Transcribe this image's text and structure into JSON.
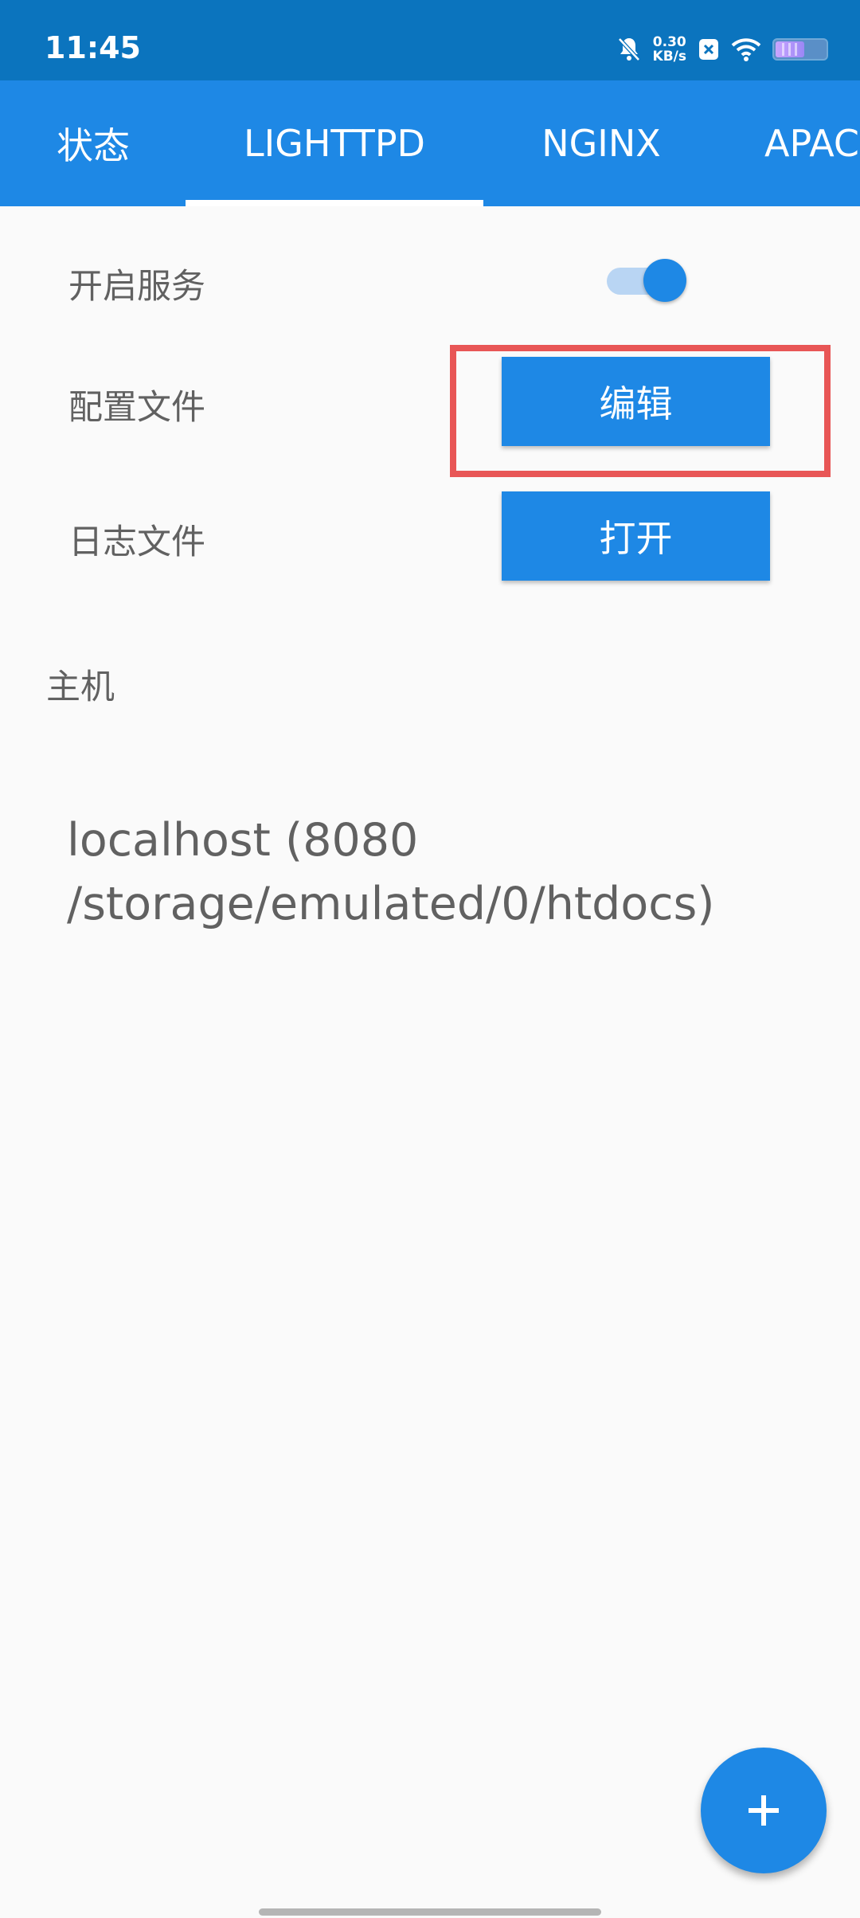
{
  "status_bar": {
    "time": "11:45",
    "net_speed_value": "0.30",
    "net_speed_unit": "KB/s",
    "icons": [
      "notifications-off-icon",
      "nfc-x-icon",
      "wifi-icon",
      "battery-icon"
    ]
  },
  "tabs": [
    {
      "label": "状态",
      "selected": false
    },
    {
      "label": "LIGHTTPD",
      "selected": true
    },
    {
      "label": "NGINX",
      "selected": false
    },
    {
      "label": "APAC",
      "selected": false
    }
  ],
  "settings": {
    "service_label": "开启服务",
    "service_enabled": true,
    "config_label": "配置文件",
    "config_button": "编辑",
    "log_label": "日志文件",
    "log_button": "打开"
  },
  "hosts": {
    "header": "主机",
    "items": [
      "localhost (8080 /storage/emulated/0/htdocs)"
    ]
  },
  "fab": {
    "icon": "plus-icon"
  },
  "colors": {
    "status_bar": "#0b74be",
    "primary": "#1e88e5",
    "background": "#fafafa",
    "text_secondary": "#616161",
    "highlight": "#e85656"
  }
}
